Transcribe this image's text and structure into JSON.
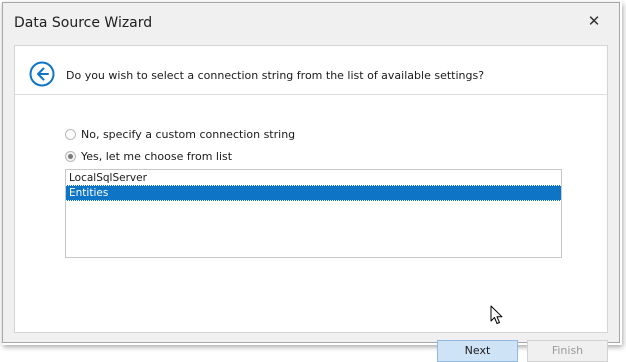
{
  "window": {
    "title": "Data Source Wizard",
    "close_symbol": "✕"
  },
  "header": {
    "question": "Do you wish to select a connection string from the list of available settings?",
    "back_icon": "back-arrow-circle-icon"
  },
  "options": [
    {
      "label": "No, specify a custom connection string",
      "checked": false
    },
    {
      "label": "Yes, let me choose from list",
      "checked": true
    }
  ],
  "connections": {
    "items": [
      "LocalSqlServer",
      "Entities"
    ],
    "selected": "Entities"
  },
  "buttons": {
    "next": "Next",
    "finish": "Finish"
  },
  "colors": {
    "accent": "#0e75c6",
    "selection": "#0e75c6",
    "next_button_bg": "#cfe3f7"
  }
}
